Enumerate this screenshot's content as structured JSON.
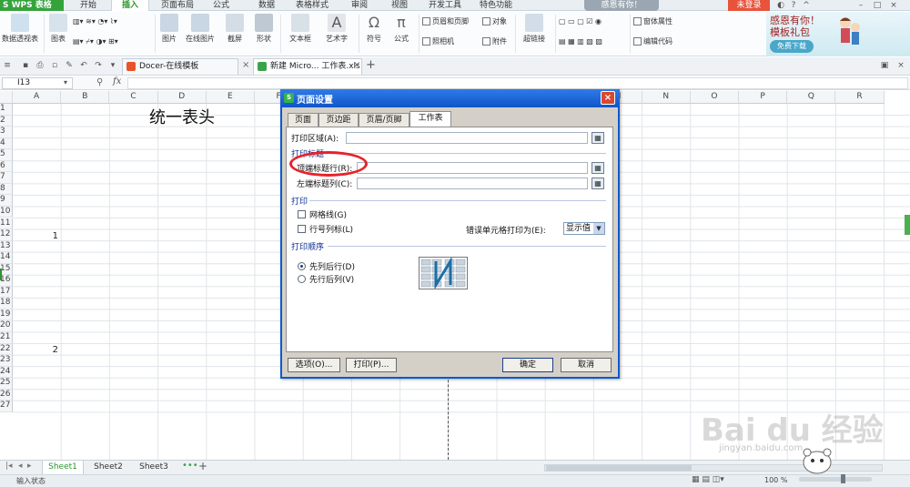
{
  "app": {
    "logo": "S WPS 表格",
    "menu_tabs": [
      {
        "label": "开始"
      },
      {
        "label": "插入"
      },
      {
        "label": "页面布局"
      },
      {
        "label": "公式"
      },
      {
        "label": "数据"
      },
      {
        "label": "表格样式"
      },
      {
        "label": "审阅"
      },
      {
        "label": "视图"
      },
      {
        "label": "开发工具"
      },
      {
        "label": "特色功能"
      }
    ],
    "active_tab": "插入",
    "promo_top": "感恩有你！",
    "login": "未登录"
  },
  "ribbon": {
    "pivot": "数据透视表",
    "chart": "图表",
    "picture": "图片",
    "online_picture": "在线图片",
    "screenshot": "截屏",
    "shapes": "形状",
    "textbox": "文本框",
    "wordart": "艺术字",
    "symbol": "符号",
    "formula": "公式",
    "header_footer": "页眉和页脚",
    "camera": "照相机",
    "object": "对象",
    "attachment": "附件",
    "hyperlink": "超链接",
    "form_props": "窗体属性",
    "edit_code": "编辑代码",
    "promo_line1": "感恩有你！",
    "promo_line2": "模板礼包",
    "promo_btn": "免费下载"
  },
  "doc_tabs": [
    {
      "label": "Docer-在线模板"
    },
    {
      "label": "新建 Micro... 工作表.xls"
    }
  ],
  "formula_bar": {
    "name_box": "I13",
    "fx": "fx"
  },
  "sheet": {
    "columns": [
      "A",
      "B",
      "C",
      "D",
      "E",
      "F",
      "G",
      "H",
      "I",
      "J",
      "K",
      "L",
      "M",
      "N",
      "O",
      "P",
      "Q",
      "R"
    ],
    "rows": [
      "1",
      "2",
      "3",
      "4",
      "5",
      "6",
      "7",
      "8",
      "9",
      "10",
      "11",
      "12",
      "13",
      "14",
      "15",
      "16",
      "17",
      "18",
      "19",
      "20",
      "21",
      "22",
      "23",
      "24",
      "25",
      "26",
      "27"
    ],
    "title": "统一表头",
    "cell_a10": "1",
    "cell_a19": "2"
  },
  "sheet_tabs": [
    "Sheet1",
    "Sheet2",
    "Sheet3"
  ],
  "status": {
    "text": "输入状态",
    "zoom": "100 %"
  },
  "watermark": {
    "main": "Bai du 经验",
    "sub": "jingyan.baidu.com"
  },
  "dialog": {
    "title": "页面设置",
    "tabs": [
      "页面",
      "页边距",
      "页眉/页脚",
      "工作表"
    ],
    "active_tab": "工作表",
    "print_area_label": "打印区域(A):",
    "print_titles_section": "打印标题",
    "top_rows_label": "顶端标题行(R):",
    "left_cols_label": "左端标题列(C):",
    "print_section": "打印",
    "gridlines_label": "网格线(G)",
    "row_col_headers_label": "行号列标(L)",
    "cell_errors_label": "错误单元格打印为(E):",
    "cell_errors_value": "显示值",
    "page_order_section": "打印顺序",
    "down_then_over": "先列后行(D)",
    "over_then_down": "先行后列(V)",
    "options_btn": "选项(O)...",
    "print_btn": "打印(P)...",
    "ok_btn": "确定",
    "cancel_btn": "取消"
  },
  "colors": {
    "accent": "#2e9430",
    "dialog_title": "#0f55c8",
    "annotation": "#e8222a"
  }
}
